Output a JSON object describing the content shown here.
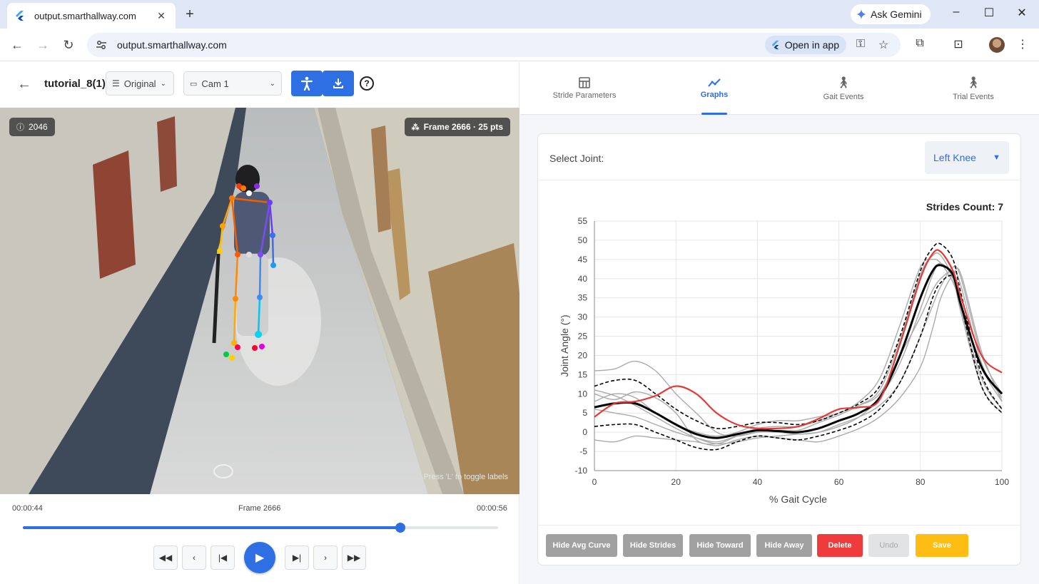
{
  "browser": {
    "tab_title": "output.smarthallway.com",
    "new_tab": "+",
    "gemini_label": "Ask Gemini",
    "url": "output.smarthallway.com",
    "open_in_app": "Open in app",
    "window_controls": [
      "–",
      "☐",
      "✕"
    ]
  },
  "player": {
    "title": "tutorial_8(1)",
    "view_mode": "Original",
    "camera": "Cam 1",
    "help": "?",
    "id_badge": "2046",
    "frame_badge": "Frame 2666 · 25 pts",
    "toggle_hint": "Press 'L' to toggle labels",
    "time_start": "00:00:44",
    "frame_label": "Frame 2666",
    "time_end": "00:00:56",
    "progress": 0.795
  },
  "tabs": [
    {
      "label": "Stride Parameters",
      "icon": "table-icon",
      "active": false
    },
    {
      "label": "Graphs",
      "icon": "graph-icon",
      "active": true
    },
    {
      "label": "Gait Events",
      "icon": "walking-icon",
      "active": false
    },
    {
      "label": "Trial Events",
      "icon": "walking-icon",
      "active": false
    }
  ],
  "graph": {
    "select_joint_label": "Select Joint:",
    "selected_joint": "Left Knee",
    "strides_count": "Strides Count: 7"
  },
  "actions": {
    "hide_avg": "Hide Avg Curve",
    "hide_strides": "Hide Strides",
    "hide_toward": "Hide Toward",
    "hide_away": "Hide Away",
    "delete": "Delete",
    "undo": "Undo",
    "save": "Save"
  },
  "colors": {
    "accent": "#2f6fe4",
    "delete": "#ef3b3b",
    "save": "#fdbd12",
    "highlight_stride": "#e53935"
  },
  "chart_data": {
    "type": "line",
    "xlabel": "% Gait Cycle",
    "ylabel": "Joint Angle (°)",
    "xlim": [
      0,
      100
    ],
    "ylim": [
      -10,
      55
    ],
    "xticks": [
      0,
      20,
      40,
      60,
      80,
      100
    ],
    "yticks": [
      -10,
      -5,
      0,
      5,
      10,
      15,
      20,
      25,
      30,
      35,
      40,
      45,
      50,
      55
    ],
    "grid": true,
    "x": [
      0,
      5,
      10,
      15,
      20,
      25,
      30,
      35,
      40,
      45,
      50,
      55,
      60,
      65,
      70,
      75,
      80,
      83,
      85,
      88,
      90,
      95,
      100
    ],
    "series": [
      {
        "role": "average",
        "style": "solid-thick",
        "color": "#000000",
        "values": [
          6.5,
          7.5,
          7.5,
          5,
          2,
          -0.5,
          -1.5,
          -0.5,
          0.5,
          0.3,
          0,
          1,
          3,
          5,
          9,
          20,
          35,
          42,
          43.5,
          41,
          33,
          17,
          10
        ]
      },
      {
        "role": "upper-sd",
        "style": "dashed",
        "color": "#000000",
        "values": [
          12,
          13.5,
          13.5,
          10,
          6,
          3,
          1,
          1.5,
          2.5,
          2.5,
          2,
          3,
          5,
          7.5,
          12,
          25,
          42,
          48,
          49,
          45,
          36,
          15,
          6
        ]
      },
      {
        "role": "lower-sd",
        "style": "dashed",
        "color": "#000000",
        "values": [
          1.5,
          2,
          2,
          0,
          -2,
          -4,
          -4.5,
          -2.5,
          -1,
          -1.5,
          -2,
          -1,
          0.5,
          2.5,
          6,
          13,
          25,
          35,
          39,
          40.5,
          33,
          12,
          5
        ]
      },
      {
        "role": "stride",
        "style": "highlight",
        "color": "#e53935",
        "values": [
          4,
          7.5,
          8,
          9.5,
          12,
          10,
          5,
          2,
          1,
          1,
          1.5,
          3.5,
          6,
          6.5,
          8.5,
          23,
          40,
          46.5,
          47,
          42,
          35,
          20,
          15.5
        ]
      },
      {
        "role": "stride",
        "style": "thin",
        "color": "#aaaaaa",
        "values": [
          16,
          16.5,
          18.5,
          16,
          10,
          5,
          0,
          -1,
          0,
          0.5,
          0.5,
          2.5,
          4.5,
          7,
          11,
          24,
          41,
          46,
          46,
          40,
          31,
          12,
          5
        ]
      },
      {
        "role": "stride",
        "style": "thin",
        "color": "#aaaaaa",
        "values": [
          8,
          10,
          9,
          5,
          2,
          0,
          -1,
          0,
          2,
          3,
          3,
          4,
          5,
          8,
          14,
          28,
          43,
          45,
          44,
          39,
          33,
          17,
          8
        ]
      },
      {
        "role": "stride",
        "style": "thin",
        "color": "#aaaaaa",
        "values": [
          10,
          8.5,
          10.5,
          9,
          5,
          -2,
          -3,
          -1,
          1,
          1.5,
          1.5,
          3,
          5,
          7,
          10,
          20,
          30,
          37,
          40,
          42,
          38,
          18,
          9
        ]
      },
      {
        "role": "stride",
        "style": "thin",
        "color": "#aaaaaa",
        "values": [
          6,
          5,
          4,
          2,
          0,
          -1.5,
          -2.5,
          -1,
          0,
          0,
          -0.5,
          0,
          2,
          4,
          7,
          13,
          25,
          33,
          38,
          43,
          40,
          20,
          10
        ]
      },
      {
        "role": "stride",
        "style": "thin",
        "color": "#aaaaaa",
        "values": [
          -2,
          -2.5,
          -1,
          -1.5,
          -2,
          -2.5,
          -3.5,
          -2,
          -1,
          -1.5,
          -2,
          -2.5,
          -1,
          1,
          4,
          9,
          17,
          27,
          35,
          41,
          41,
          21,
          8
        ]
      },
      {
        "role": "stride",
        "style": "thin",
        "color": "#aaaaaa",
        "values": [
          11,
          9.5,
          7,
          4,
          1,
          -1.5,
          -3,
          -2.5,
          -1.5,
          -1,
          -0.5,
          0,
          1.5,
          4,
          9,
          18,
          32,
          41,
          44,
          40,
          32,
          14,
          6
        ]
      }
    ]
  }
}
